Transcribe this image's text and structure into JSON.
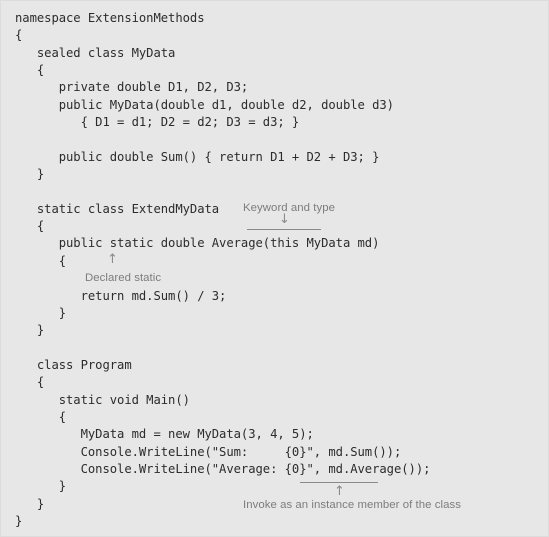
{
  "figure": {
    "background_color": "#e7e7e7",
    "code_color": "#2c2c2c",
    "annotation_color": "#7d7d7d",
    "rule_color": "#8a8a8a",
    "language": "C#"
  },
  "code": {
    "lines": [
      "namespace ExtensionMethods",
      "{",
      "   sealed class MyData",
      "   {",
      "      private double D1, D2, D3;",
      "      public MyData(double d1, double d2, double d3)",
      "         { D1 = d1; D2 = d2; D3 = d3; }",
      "",
      "      public double Sum() { return D1 + D2 + D3; }",
      "   }",
      "",
      "   static class ExtendMyData",
      "   {",
      "      public static double Average(this MyData md)",
      "      {",
      "",
      "         return md.Sum() / 3;",
      "      }",
      "   }",
      "",
      "   class Program",
      "   {",
      "      static void Main()",
      "      {",
      "         MyData md = new MyData(3, 4, 5);",
      "         Console.WriteLine(\"Sum:     {0}\", md.Sum());",
      "         Console.WriteLine(\"Average: {0}\", md.Average());",
      "      }",
      "   }",
      "}"
    ]
  },
  "annotations": {
    "keyword_and_type": {
      "label": "Keyword and type",
      "arrow": "↓",
      "points_to": "this MyData"
    },
    "declared_static": {
      "label": "Declared static",
      "arrow": "↑",
      "points_to": "static"
    },
    "invoke_as_instance_member": {
      "label": "Invoke as an instance member of the class",
      "arrow": "↑",
      "points_to": "md.Average()"
    }
  }
}
